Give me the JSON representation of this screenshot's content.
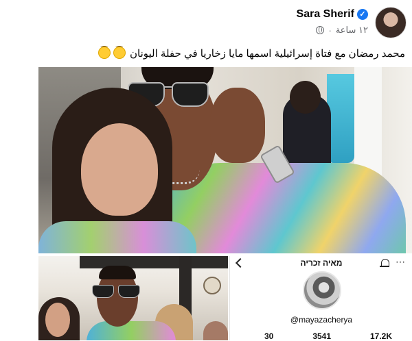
{
  "post": {
    "author": "Sara Sherif",
    "time": "١٢ ساعة",
    "separator": "·",
    "caption": "محمد رمضان مع فتاة إسرائيلية اسمها مايا زخاريا في حفلة اليونان",
    "emojis": [
      "upside-down-face-icon",
      "upside-down-face-icon"
    ]
  },
  "instagram_card": {
    "display_name": "מאיה זכריה",
    "handle": "@mayazacherya",
    "stats": [
      "30",
      "3541",
      "17.2K"
    ]
  },
  "colors": {
    "verified": "#1877f2",
    "text": "#050505",
    "meta": "#65676b"
  }
}
